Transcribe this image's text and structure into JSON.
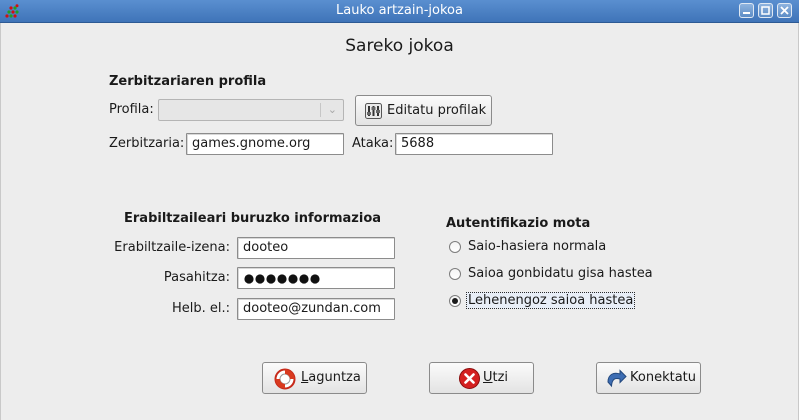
{
  "window": {
    "title": "Lauko artzain-jokoa",
    "controls": [
      "minimize-icon",
      "maximize-icon",
      "close-icon"
    ]
  },
  "dialog": {
    "heading": "Sareko jokoa",
    "server_section": {
      "title": "Zerbitzariaren profila",
      "profile_label": "Profila:",
      "profile_value": "",
      "edit_profiles_label": "Editatu profilak",
      "server_label": "Zerbitzaria:",
      "server_value": "games.gnome.org",
      "port_label": "Ataka:",
      "port_value": "5688"
    },
    "user_section": {
      "title": "Erabiltzaileari buruzko informazioa",
      "username_label": "Erabiltzaile-izena:",
      "username_value": "dooteo",
      "password_label": "Pasahitza:",
      "password_dots": 7,
      "email_label": "Helb. el.:",
      "email_value": "dooteo@zundan.com"
    },
    "auth_section": {
      "title": "Autentifikazio mota",
      "options": [
        {
          "label": "Saio-hasiera normala",
          "selected": false
        },
        {
          "label": "Saioa gonbidatu gisa hastea",
          "selected": false
        },
        {
          "label": "Lehenengoz saioa hastea",
          "selected": true
        }
      ]
    },
    "buttons": {
      "help": {
        "mnemonic": "L",
        "rest": "aguntza"
      },
      "cancel": {
        "mnemonic": "U",
        "rest": "tzi"
      },
      "connect": {
        "label": "Konektatu"
      }
    }
  }
}
